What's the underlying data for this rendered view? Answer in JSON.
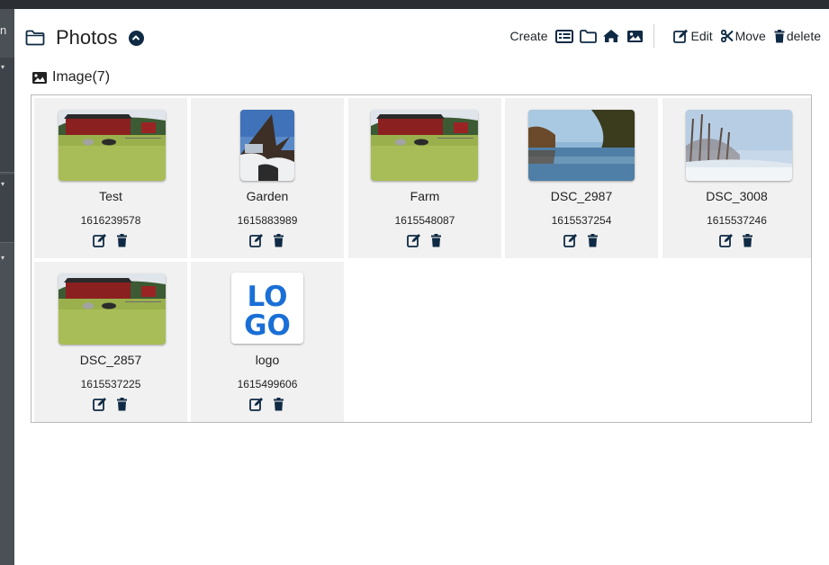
{
  "sidebar": {
    "top_fragment": "n"
  },
  "header": {
    "title": "Photos"
  },
  "toolbar": {
    "create_label": "Create",
    "icons": [
      "table-list-icon",
      "folder-icon",
      "home-icon",
      "image-icon"
    ],
    "edit_label": "Edit",
    "move_label": "Move",
    "delete_label": "delete"
  },
  "section": {
    "label": "Image(7)"
  },
  "items": [
    {
      "name": "Test",
      "timestamp": "1616239578",
      "thumb": "farm-scene"
    },
    {
      "name": "Garden",
      "timestamp": "1615883989",
      "thumb": "garden-snow"
    },
    {
      "name": "Farm",
      "timestamp": "1615548087",
      "thumb": "farm-scene"
    },
    {
      "name": "DSC_2987",
      "timestamp": "1615537254",
      "thumb": "lake-sunset"
    },
    {
      "name": "DSC_3008",
      "timestamp": "1615537246",
      "thumb": "winter-trees"
    },
    {
      "name": "DSC_2857",
      "timestamp": "1615537225",
      "thumb": "farm-scene"
    },
    {
      "name": "logo",
      "timestamp": "1615499606",
      "thumb": "logo"
    }
  ],
  "logo_text": {
    "line1": "LO",
    "line2": "GO"
  },
  "colors": {
    "icon": "#0f2a44",
    "cell_bg": "#f1f1f1",
    "logo_blue": "#1a6fd6",
    "sidebar": "#4a5056"
  }
}
